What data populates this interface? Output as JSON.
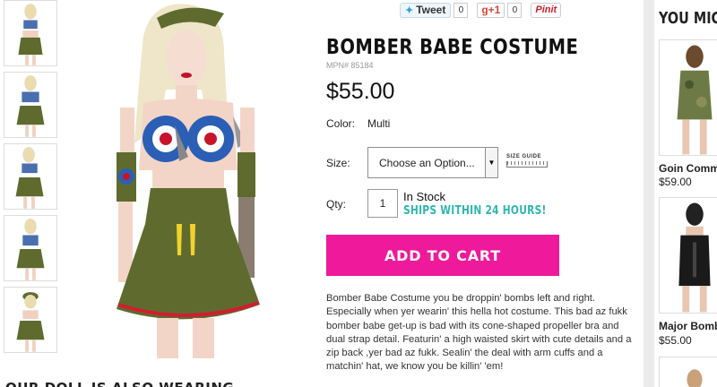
{
  "social": {
    "tweet_label": "Tweet",
    "tweet_count": "0",
    "gplus_label": "g+1",
    "gplus_count": "0",
    "pinit_label": "Pinit"
  },
  "product": {
    "title": "BOMBER BABE COSTUME",
    "mpn": "MPN# 85184",
    "price": "$55.00",
    "color_label": "Color:",
    "color_value": "Multi",
    "size_label": "Size:",
    "size_selected": "Choose an Option...",
    "size_guide": "SIZE GUIDE",
    "qty_label": "Qty:",
    "qty_value": "1",
    "stock": "In Stock",
    "ships": "SHIPS WITHIN 24 HOURS!",
    "add_to_cart": "ADD TO CART",
    "description": "Bomber Babe Costume you be droppin' bombs left and right. Especially when yer wearin' this hella hot costume. This bad az fukk bomber babe get-up is bad with its cone-shaped propeller bra and dual strap detail. Featurin' a high waisted skirt with cute details and a zip back ,yer bad az fukk. Sealin' the deal with arm cuffs and a matchin' hat, we know you be killin' 'em!"
  },
  "bottom_heading": "OUR DOLL IS ALSO WEARING",
  "rail": {
    "title": "YOU MIGHT ALSO LIKE",
    "items": [
      {
        "name": "Goin Commando",
        "price": "$59.00"
      },
      {
        "name": "Major Bombshell",
        "price": "$55.00"
      }
    ]
  },
  "colors": {
    "accent": "#ee1a9b",
    "ships": "#2fb7b0",
    "costume_green": "#5f6b2e"
  }
}
